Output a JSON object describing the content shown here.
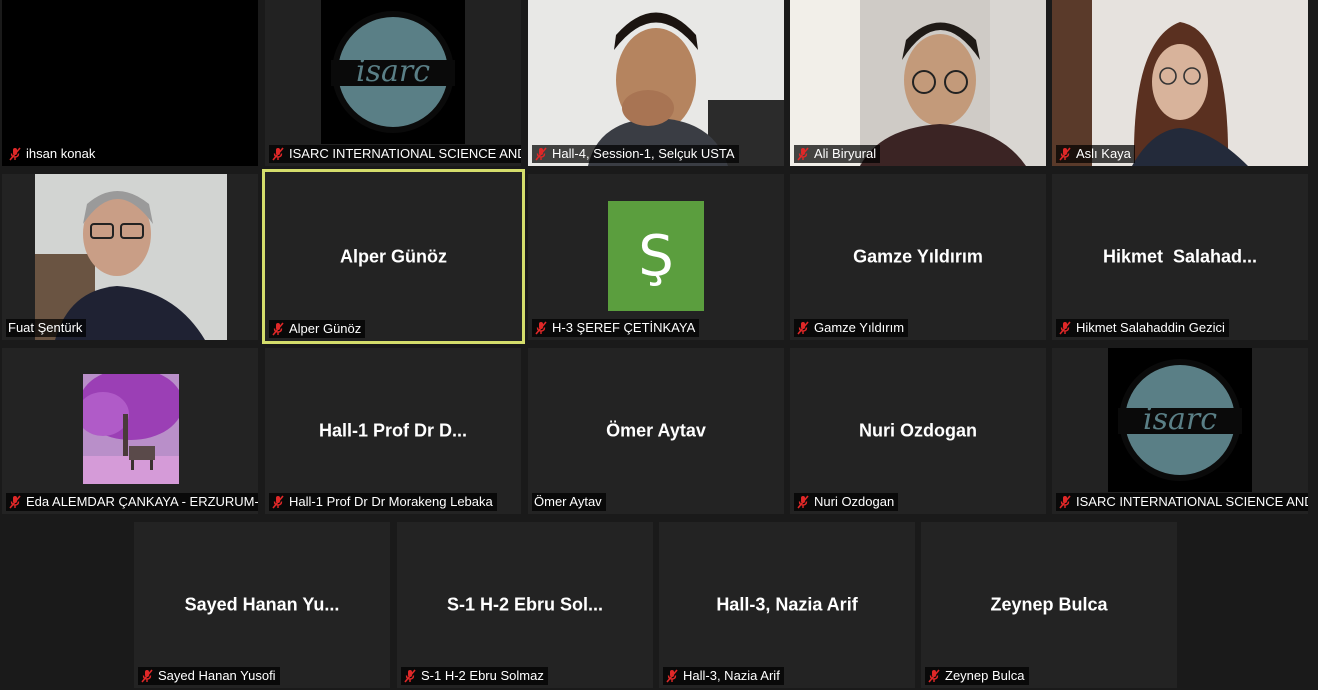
{
  "colors": {
    "tile_bg": "#232323",
    "active_border": "#d4dd6b",
    "muted_icon": "#e02828",
    "avatar_green": "#5b9e3e"
  },
  "participants": [
    {
      "label": "ihsan konak",
      "muted": true
    },
    {
      "label": "ISARC INTERNATIONAL SCIENCE AND...",
      "muted": true,
      "logo_text": "isarc",
      "logo_ring_text": "NATIONAL SCIENCE AND ART RESEARCH C"
    },
    {
      "label": "Hall-4, Session-1, Selçuk USTA",
      "muted": true
    },
    {
      "label": "Ali Biryural",
      "muted": true
    },
    {
      "label": "Aslı Kaya",
      "muted": true
    },
    {
      "label": "Fuat Şentürk",
      "muted": false
    },
    {
      "label": "Alper Günöz",
      "display": "Alper Günöz",
      "muted": true,
      "speaking": true
    },
    {
      "label": "H-3 ŞEREF ÇETİNKAYA",
      "muted": true,
      "initial": "Ş"
    },
    {
      "label": "Gamze Yıldırım",
      "display": "Gamze Yıldırım",
      "muted": true
    },
    {
      "label": "Hikmet Salahaddin Gezici",
      "display": "Hikmet  Salahad...",
      "muted": true
    },
    {
      "label": "Eda ALEMDAR ÇANKAYA - ERZURUM-...",
      "muted": true
    },
    {
      "label": "Hall-1 Prof Dr Dr Morakeng Lebaka",
      "display": "Hall-1 Prof Dr D...",
      "muted": true
    },
    {
      "label": "Ömer Aytav",
      "display": "Ömer Aytav",
      "muted": false
    },
    {
      "label": "Nuri Ozdogan",
      "display": "Nuri Ozdogan",
      "muted": true
    },
    {
      "label": "ISARC INTERNATIONAL SCIENCE AND...",
      "muted": true,
      "logo_text": "isarc",
      "logo_ring_text": "NATIONAL SCIENCE AND ART RESEARCH C"
    },
    {
      "label": "Sayed Hanan Yusofi",
      "display": "Sayed Hanan Yu...",
      "muted": true
    },
    {
      "label": "S-1 H-2 Ebru Solmaz",
      "display": "S-1 H-2 Ebru Sol...",
      "muted": true
    },
    {
      "label": "Hall-3, Nazia Arif",
      "display": "Hall-3, Nazia Arif",
      "muted": true
    },
    {
      "label": "Zeynep Bulca",
      "display": "Zeynep Bulca",
      "muted": true
    }
  ]
}
